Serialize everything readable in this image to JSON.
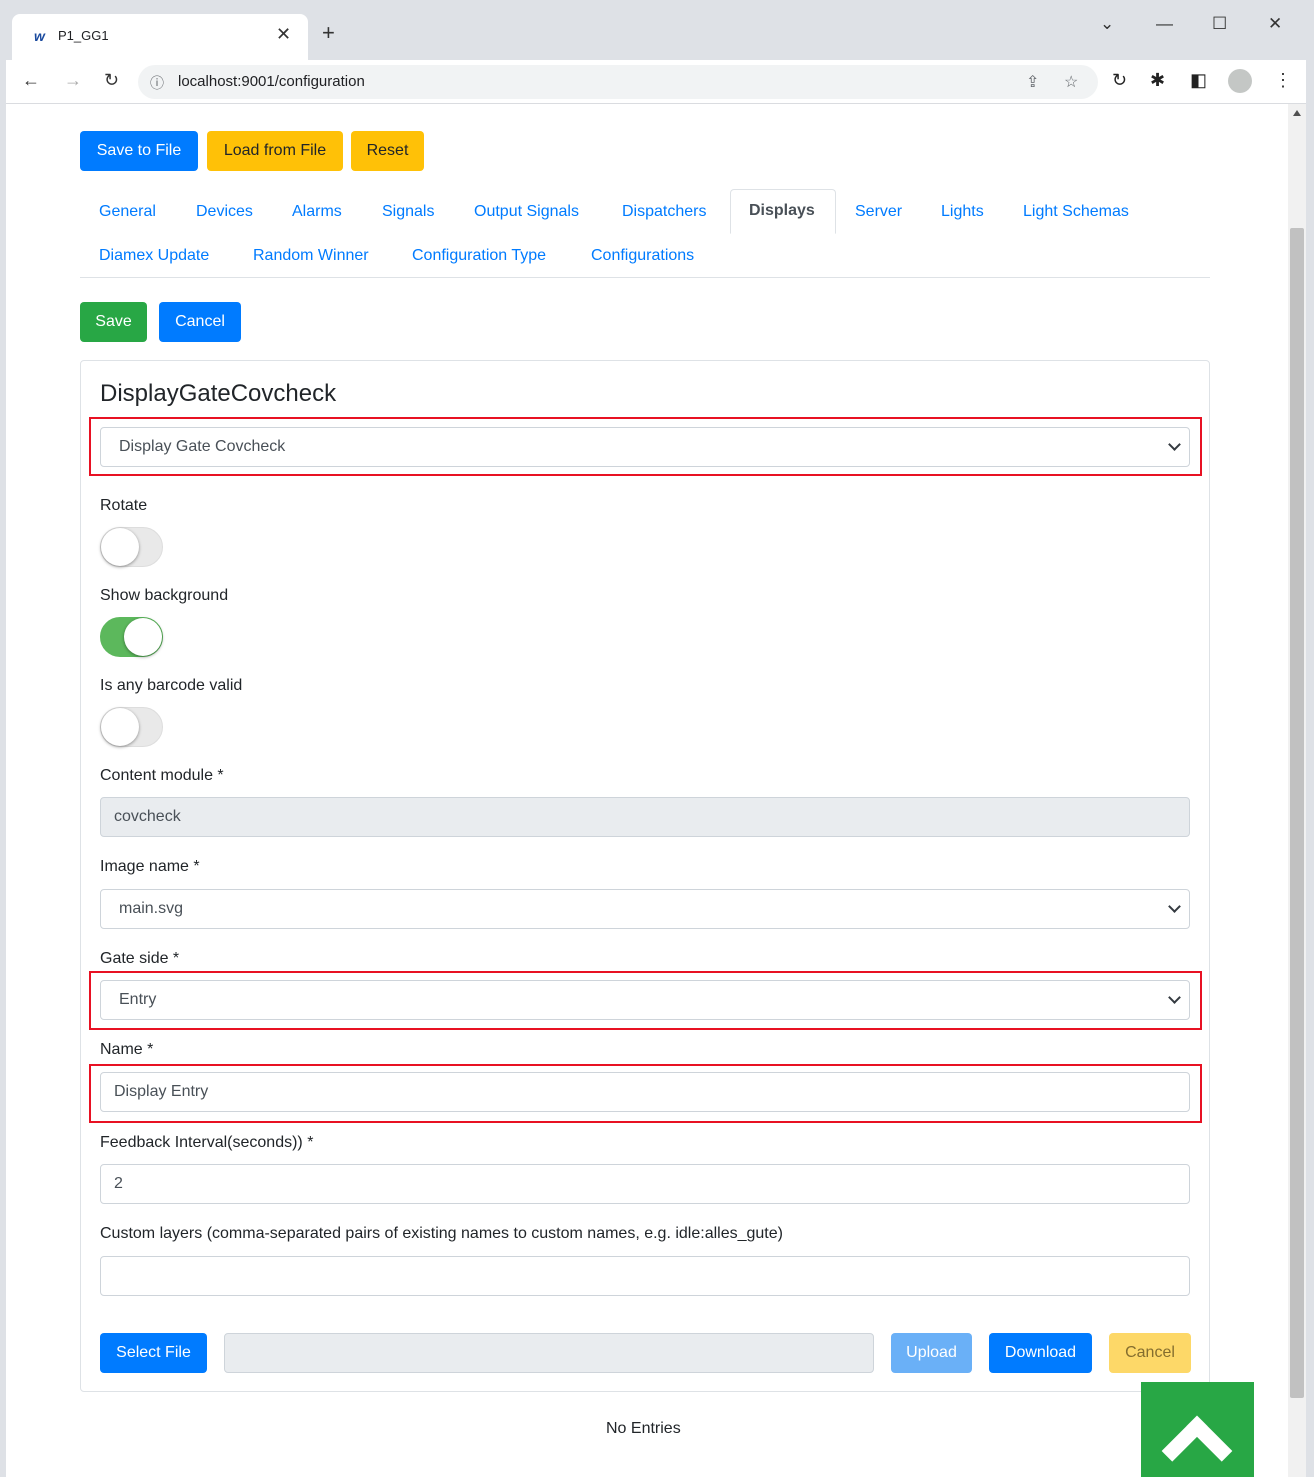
{
  "browser": {
    "tab_title": "P1_GG1",
    "favicon": "w",
    "url": "localhost:9001/configuration"
  },
  "toolbar": {
    "save_to_file": "Save to File",
    "load_from_file": "Load from File",
    "reset": "Reset"
  },
  "nav": {
    "tabs": [
      {
        "label": "General"
      },
      {
        "label": "Devices"
      },
      {
        "label": "Alarms"
      },
      {
        "label": "Signals"
      },
      {
        "label": "Output Signals"
      },
      {
        "label": "Dispatchers"
      },
      {
        "label": "Displays",
        "active": true
      },
      {
        "label": "Server"
      },
      {
        "label": "Lights"
      },
      {
        "label": "Light Schemas"
      },
      {
        "label": "Diamex Update"
      },
      {
        "label": "Random Winner"
      },
      {
        "label": "Configuration Type"
      },
      {
        "label": "Configurations"
      }
    ]
  },
  "actions": {
    "save": "Save",
    "cancel": "Cancel"
  },
  "form": {
    "title": "DisplayGateCovcheck",
    "display_select": "Display Gate Covcheck",
    "rotate": {
      "label": "Rotate",
      "on": false
    },
    "show_background": {
      "label": "Show background",
      "on": true
    },
    "any_barcode": {
      "label": "Is any barcode valid",
      "on": false
    },
    "content_module": {
      "label": "Content module *",
      "value": "covcheck"
    },
    "image_name": {
      "label": "Image name *",
      "value": "main.svg"
    },
    "gate_side": {
      "label": "Gate side *",
      "value": "Entry"
    },
    "name": {
      "label": "Name *",
      "value": "Display Entry"
    },
    "feedback_interval": {
      "label": "Feedback Interval(seconds)) *",
      "value": "2"
    },
    "custom_layers": {
      "label": "Custom layers (comma-separated pairs of existing names to custom names, e.g. idle:alles_gute)",
      "value": ""
    }
  },
  "file": {
    "select": "Select File",
    "upload": "Upload",
    "download": "Download",
    "cancel": "Cancel"
  },
  "empty_text": "No Entries",
  "colors": {
    "primary": "#007bff",
    "warning": "#ffc107",
    "success": "#28a745",
    "highlight": "#e81123"
  }
}
